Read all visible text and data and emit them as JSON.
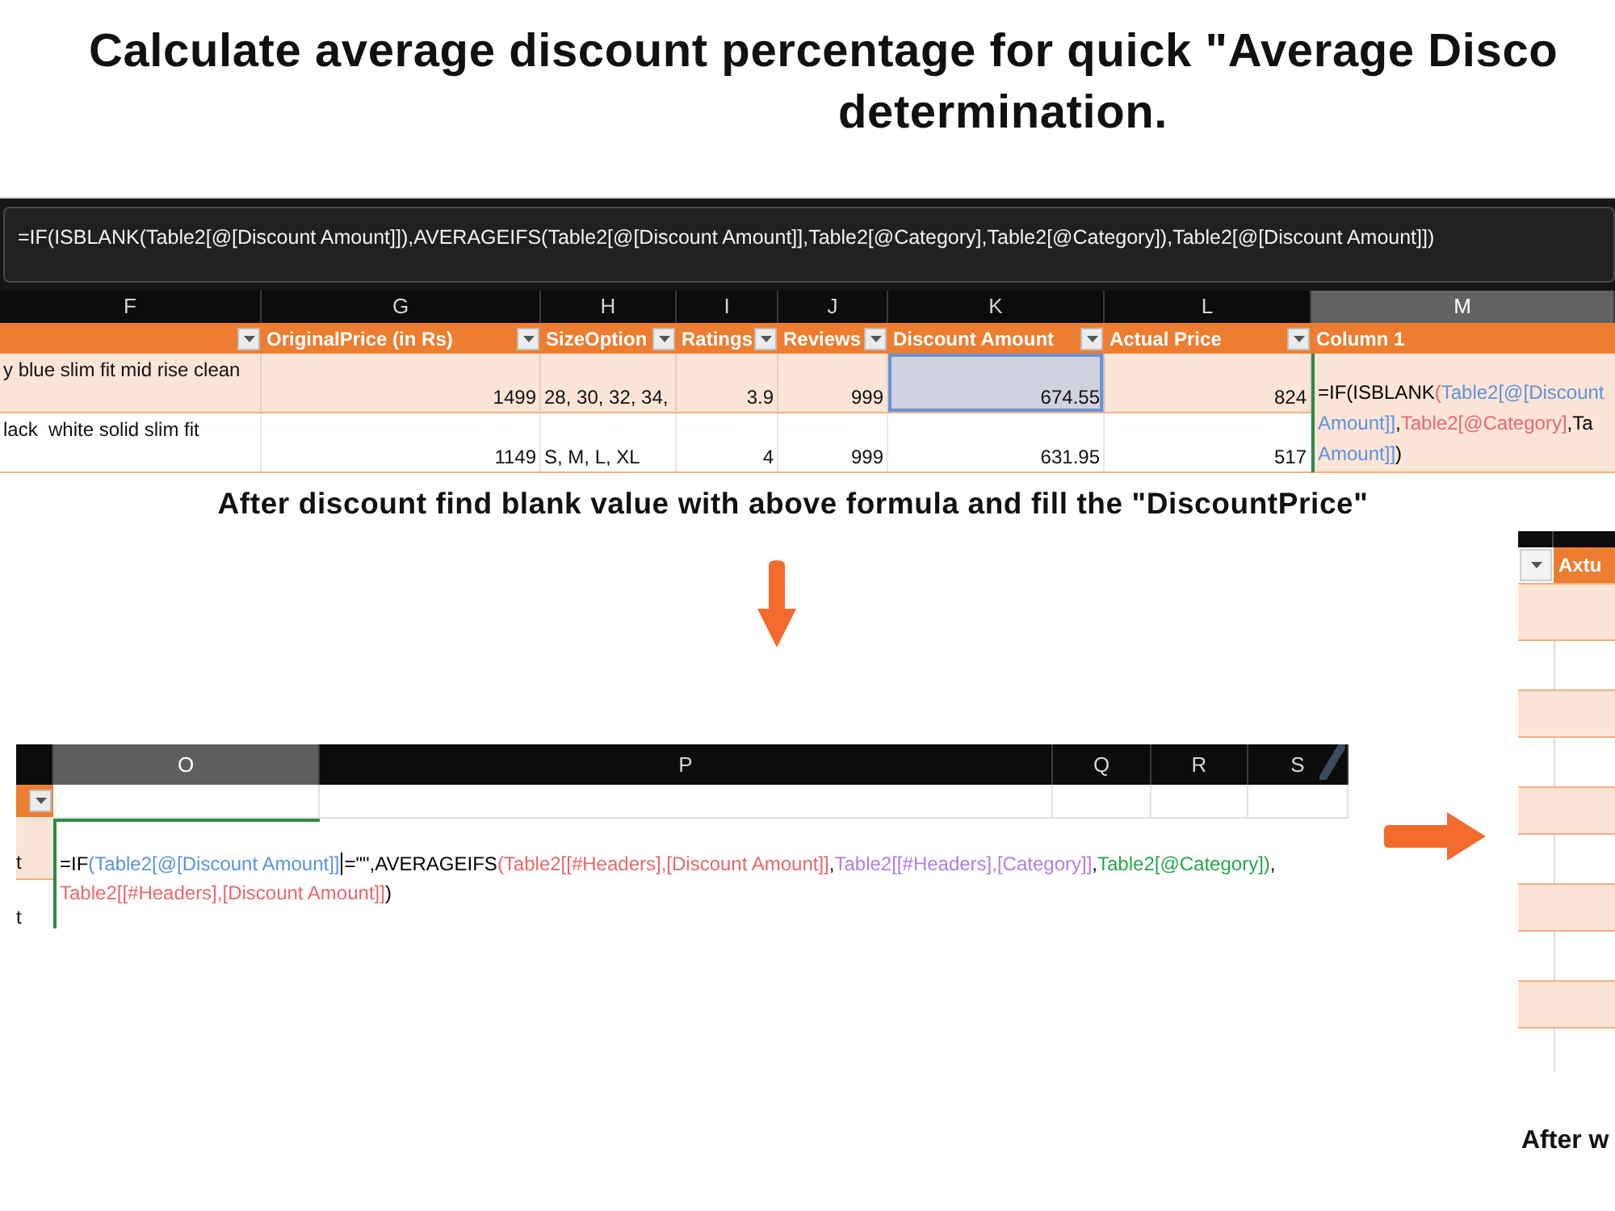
{
  "title": {
    "lines": [
      "Calculate average discount percentage for quick \"Average Disco",
      "determination."
    ]
  },
  "formula_sheet": {
    "formula_bar": "=IF(ISBLANK(Table2[@[Discount Amount]]),AVERAGEIFS(Table2[@[Discount Amount]],Table2[@Category],Table2[@Category]),Table2[@[Discount Amount]])",
    "columns": [
      {
        "letter": "F",
        "selected": false,
        "kind": "wrap",
        "filter": true
      },
      {
        "letter": "G",
        "selected": false,
        "kind": "number",
        "header": "OriginalPrice (in Rs)",
        "filter": true
      },
      {
        "letter": "H",
        "selected": false,
        "kind": "text",
        "header": "SizeOption",
        "filter": true
      },
      {
        "letter": "I",
        "selected": false,
        "kind": "number",
        "header": "Ratings",
        "filter": true
      },
      {
        "letter": "J",
        "selected": false,
        "kind": "number",
        "header": "Reviews",
        "filter": true
      },
      {
        "letter": "K",
        "selected": false,
        "kind": "number",
        "header": "Discount Amount",
        "filter": true
      },
      {
        "letter": "L",
        "selected": false,
        "kind": "number",
        "header": "Actual Price",
        "filter": true
      },
      {
        "letter": "M",
        "selected": true,
        "kind": "editor",
        "header": "Column 1"
      }
    ],
    "rows": [
      {
        "banded": true,
        "cells": [
          {
            "text": "y blue slim fit mid rise clean",
            "selected": false
          },
          {
            "text": "1499",
            "selected": false
          },
          {
            "text": "28, 30, 32, 34,",
            "selected": false
          },
          {
            "text": "3.9",
            "selected": false
          },
          {
            "text": "999",
            "selected": false
          },
          {
            "text": "674.55",
            "selected": true
          },
          {
            "text": "824",
            "selected": false
          }
        ]
      },
      {
        "banded": false,
        "cells": [
          {
            "text": "lack  white solid slim fit",
            "selected": false
          },
          {
            "text": "1149",
            "selected": false
          },
          {
            "text": "S, M, L, XL",
            "selected": false
          },
          {
            "text": "4",
            "selected": false
          },
          {
            "text": "999",
            "selected": false
          },
          {
            "text": "631.95",
            "selected": false
          },
          {
            "text": "517",
            "selected": false
          }
        ]
      }
    ],
    "editor": {
      "lines": [
        [
          {
            "kind": "text",
            "text": "=IF(ISBLANK",
            "color": "#000000"
          },
          {
            "kind": "text",
            "text": "(",
            "color": "#e8686a"
          },
          {
            "kind": "text",
            "text": "Table2[@[Discount",
            "color": "#5b93dd"
          }
        ],
        [
          {
            "kind": "text",
            "text": "Amount]]",
            "color": "#5b93dd"
          },
          {
            "kind": "text",
            "text": ",",
            "color": "#000000"
          },
          {
            "kind": "text",
            "text": "Table2[@Category]",
            "color": "#e8686a"
          },
          {
            "kind": "text",
            "text": ",Ta",
            "color": "#000000"
          }
        ],
        [
          {
            "kind": "text",
            "text": "Amount]]",
            "color": "#5b93dd"
          },
          {
            "kind": "text",
            "text": ")",
            "color": "#000000"
          }
        ]
      ]
    }
  },
  "caption": "After discount find blank value with above formula and fill the \"DiscountPrice\"",
  "edit_sheet": {
    "columns": [
      {
        "letter": "O",
        "selected": true
      },
      {
        "letter": "P",
        "selected": false
      },
      {
        "letter": "Q",
        "selected": false
      },
      {
        "letter": "R",
        "selected": false
      },
      {
        "letter": "S",
        "selected": false
      }
    ],
    "side_column": {
      "filter": true,
      "cells": [
        {
          "text": "t",
          "banded": true
        },
        {
          "text": "t",
          "banded": false
        }
      ]
    },
    "editor": {
      "lines": [
        [
          {
            "kind": "text",
            "text": "=IF",
            "color": "#000000"
          },
          {
            "kind": "text",
            "text": "(Table2[@[Discount Amount]]",
            "color": "#5b93dd"
          },
          {
            "kind": "caret"
          },
          {
            "kind": "text",
            "text": "=\"\",AVERAGEIFS",
            "color": "#000000"
          },
          {
            "kind": "text",
            "text": "(Table2[[#Headers],[Discount Amount]]",
            "color": "#e8686a"
          },
          {
            "kind": "text",
            "text": ",",
            "color": "#000000"
          },
          {
            "kind": "text",
            "text": "Table2[[#Headers],[Category]]",
            "color": "#b07ee8"
          },
          {
            "kind": "text",
            "text": ",",
            "color": "#000000"
          },
          {
            "kind": "text",
            "text": "Table2[@Category])",
            "color": "#2aa44f"
          },
          {
            "kind": "text",
            "text": ",",
            "color": "#000000"
          }
        ],
        [
          {
            "kind": "text",
            "text": "Table2[[#Headers],[Discount Amount]]",
            "color": "#e8686a"
          },
          {
            "kind": "text",
            "text": ")",
            "color": "#000000"
          }
        ]
      ]
    }
  },
  "result_sheet": {
    "filter": true,
    "header": "Axtu",
    "rows": [
      {
        "banded": true
      },
      {
        "banded": false
      },
      {
        "banded": true
      },
      {
        "banded": false
      },
      {
        "banded": true
      },
      {
        "banded": false
      },
      {
        "banded": true
      },
      {
        "banded": false
      },
      {
        "banded": true
      },
      {
        "banded": false
      }
    ],
    "caption": "After w"
  }
}
